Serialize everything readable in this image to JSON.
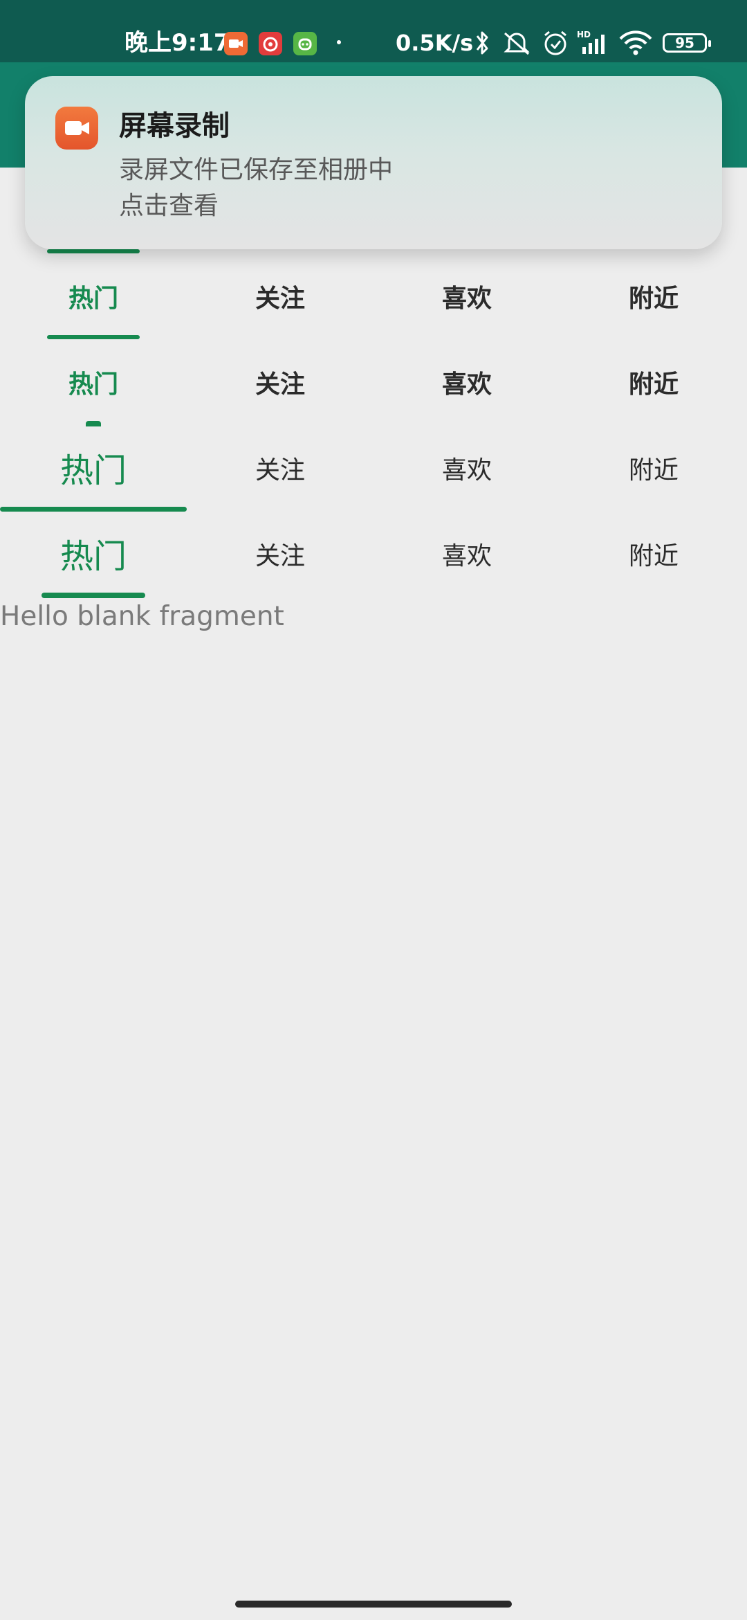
{
  "status_bar": {
    "time": "晚上9:17",
    "network_speed": "0.5K/s",
    "signal_label": "HD",
    "battery": "95",
    "icons": [
      "screen-recorder-icon",
      "music-app-icon",
      "game-app-icon",
      "bluetooth-icon",
      "mute-icon",
      "alarm-icon",
      "signal-icon",
      "wifi-icon",
      "battery-icon"
    ]
  },
  "notification": {
    "app_icon": "video-camera-icon",
    "title": "屏幕录制",
    "line1": "录屏文件已保存至相册中",
    "line2": "点击查看"
  },
  "tab_bars": [
    {
      "tabs": [
        "热门",
        "关注",
        "喜欢",
        "附近"
      ],
      "selected": 0
    },
    {
      "tabs": [
        "热门",
        "关注",
        "喜欢",
        "附近"
      ],
      "selected": 0
    },
    {
      "tabs": [
        "热门",
        "关注",
        "喜欢",
        "附近"
      ],
      "selected": 0
    },
    {
      "tabs": [
        "热门",
        "关注",
        "喜欢",
        "附近"
      ],
      "selected": 0
    }
  ],
  "content": {
    "text": "Hello blank fragment"
  },
  "colors": {
    "accent": "#168a4f",
    "status_bar": "#0f5b50",
    "toolbar": "#12806a",
    "background": "#ededed"
  }
}
